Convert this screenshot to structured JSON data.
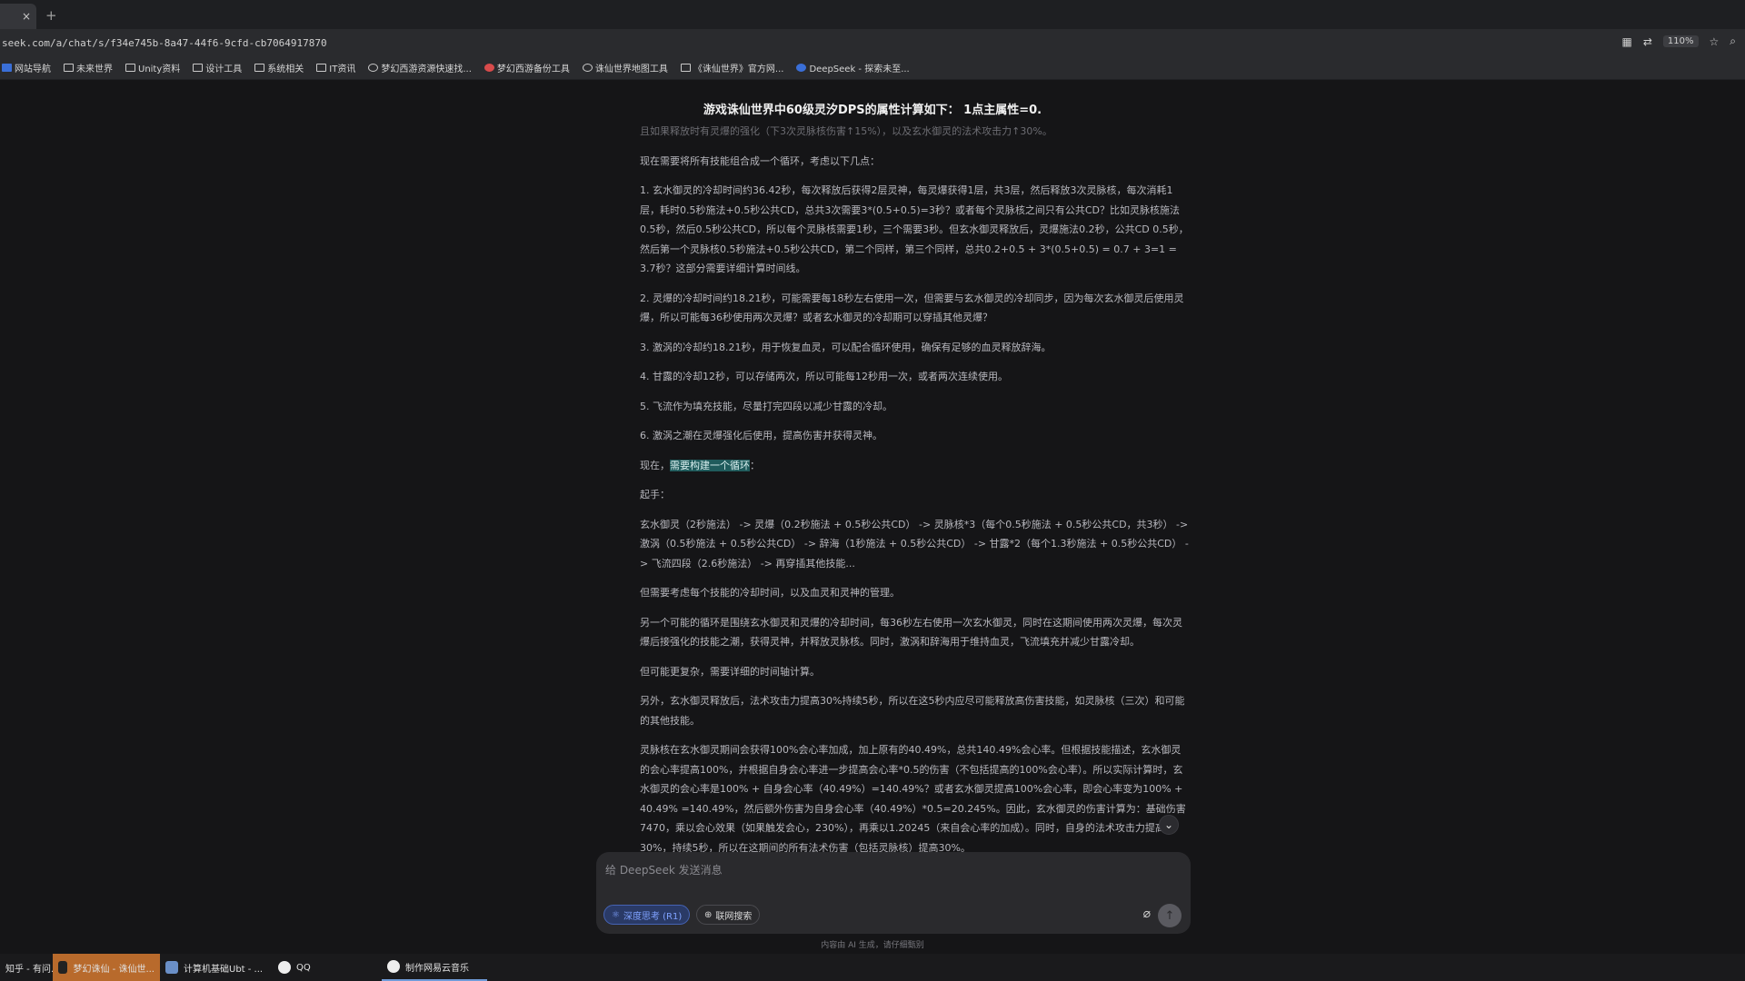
{
  "browser": {
    "tab_close": "×",
    "new_tab": "+",
    "url": "seek.com/a/chat/s/f34e745b-8a47-44f6-9cfd-cb7064917870",
    "zoom": "110%"
  },
  "bookmarks": [
    {
      "label": "网站导航",
      "icon": "bookmark-blue"
    },
    {
      "label": "未来世界",
      "icon": "folder"
    },
    {
      "label": "Unity资料",
      "icon": "folder"
    },
    {
      "label": "设计工具",
      "icon": "folder"
    },
    {
      "label": "系统相关",
      "icon": "folder"
    },
    {
      "label": "IT资讯",
      "icon": "folder"
    },
    {
      "label": "梦幻西游资源快速找...",
      "icon": "search"
    },
    {
      "label": "梦幻西游备份工具",
      "icon": "game"
    },
    {
      "label": "诛仙世界地图工具",
      "icon": "globe"
    },
    {
      "label": "《诛仙世界》官方网...",
      "icon": "page"
    },
    {
      "label": "DeepSeek - 探索未至...",
      "icon": "deepseek"
    }
  ],
  "chat": {
    "title": "游戏诛仙世界中60级灵汐DPS的属性计算如下： 1点主属性=0.",
    "faded_line": "且如果释放时有灵爆的强化（下3次灵脉核伤害↑15%），以及玄水御灵的法术攻击力↑30%。",
    "paragraphs": [
      "现在需要将所有技能组合成一个循环，考虑以下几点：",
      "1. 玄水御灵的冷却时间约36.42秒，每次释放后获得2层灵神，每灵爆获得1层，共3层，然后释放3次灵脉核，每次消耗1层，耗时0.5秒施法+0.5秒公共CD，总共3次需要3*(0.5+0.5)=3秒？或者每个灵脉核之间只有公共CD？比如灵脉核施法0.5秒，然后0.5秒公共CD，所以每个灵脉核需要1秒，三个需要3秒。但玄水御灵释放后，灵爆施法0.2秒，公共CD 0.5秒，然后第一个灵脉核0.5秒施法+0.5秒公共CD，第二个同样，第三个同样，总共0.2+0.5 + 3*(0.5+0.5) = 0.7 + 3=1 = 3.7秒？这部分需要详细计算时间线。",
      "2. 灵爆的冷却时间约18.21秒，可能需要每18秒左右使用一次，但需要与玄水御灵的冷却同步，因为每次玄水御灵后使用灵爆，所以可能每36秒使用两次灵爆？或者玄水御灵的冷却期可以穿插其他灵爆？",
      "3. 激涡的冷却约18.21秒，用于恢复血灵，可以配合循环使用，确保有足够的血灵释放辞海。",
      "4. 甘露的冷却12秒，可以存储两次，所以可能每12秒用一次，或者两次连续使用。",
      "5. 飞流作为填充技能，尽量打完四段以减少甘露的冷却。",
      "6. 激涡之潮在灵爆强化后使用，提高伤害并获得灵神。"
    ],
    "now_prefix": "现在，",
    "now_highlight": "需要构建一个循环",
    "now_suffix": "：",
    "opening_label": "起手：",
    "rotation": "玄水御灵（2秒施法） -> 灵爆（0.2秒施法 + 0.5秒公共CD） -> 灵脉核*3（每个0.5秒施法 + 0.5秒公共CD，共3秒） -> 激涡（0.5秒施法 + 0.5秒公共CD） -> 辞海（1秒施法 + 0.5秒公共CD） -> 甘露*2（每个1.3秒施法 + 0.5秒公共CD） -> 飞流四段（2.6秒施法） -> 再穿插其他技能...",
    "paragraphs2": [
      "但需要考虑每个技能的冷却时间，以及血灵和灵神的管理。",
      "另一个可能的循环是围绕玄水御灵和灵爆的冷却时间，每36秒左右使用一次玄水御灵，同时在这期间使用两次灵爆，每次灵爆后接强化的技能之潮，获得灵神，并释放灵脉核。同时，激涡和辞海用于维持血灵，飞流填充并减少甘露冷却。",
      "但可能更复杂，需要详细的时间轴计算。",
      "另外，玄水御灵释放后，法术攻击力提高30%持续5秒，所以在这5秒内应尽可能释放高伤害技能，如灵脉核（三次）和可能的其他技能。",
      "灵脉核在玄水御灵期间会获得100%会心率加成，加上原有的40.49%，总共140.49%会心率。但根据技能描述，玄水御灵的会心率提高100%，并根据自身会心率进一步提高会心率*0.5的伤害（不包括提高的100%会心率）。所以实际计算时，玄水御灵的会心率是100% + 自身会心率（40.49%）=140.49%？或者玄水御灵提高100%会心率，即会心率变为100% + 40.49% =140.49%，然后额外伤害为自身会心率（40.49%）*0.5=20.245%。因此，玄水御灵的伤害计算为：基础伤害7470，乘以会心效果（如果触发会心，230%），再乘以1.20245（来自会心率的加成）。同时，自身的法术攻击力提高30%，持续5秒，所以在这期间的所有法术伤害（包括灵脉核）提高30%。"
    ]
  },
  "composer": {
    "placeholder": "给 DeepSeek 发送消息",
    "deep_think": "深度思考 (R1)",
    "web_search": "联网搜索",
    "disclaimer": "内容由 AI 生成，请仔细甄别"
  },
  "taskbar": [
    {
      "label": "知乎 - 有问...",
      "active": false
    },
    {
      "label": "梦幻诛仙 - 诛仙世...",
      "active": true
    },
    {
      "label": "计算机基础Ubt - ...",
      "active": false
    },
    {
      "label": "QQ",
      "active": false
    },
    {
      "label": "制作网易云音乐",
      "active": false
    }
  ],
  "colors": {
    "accent": "#4d6bfe",
    "highlight": "#1f5b5c",
    "active_task": "#b86a2c"
  }
}
